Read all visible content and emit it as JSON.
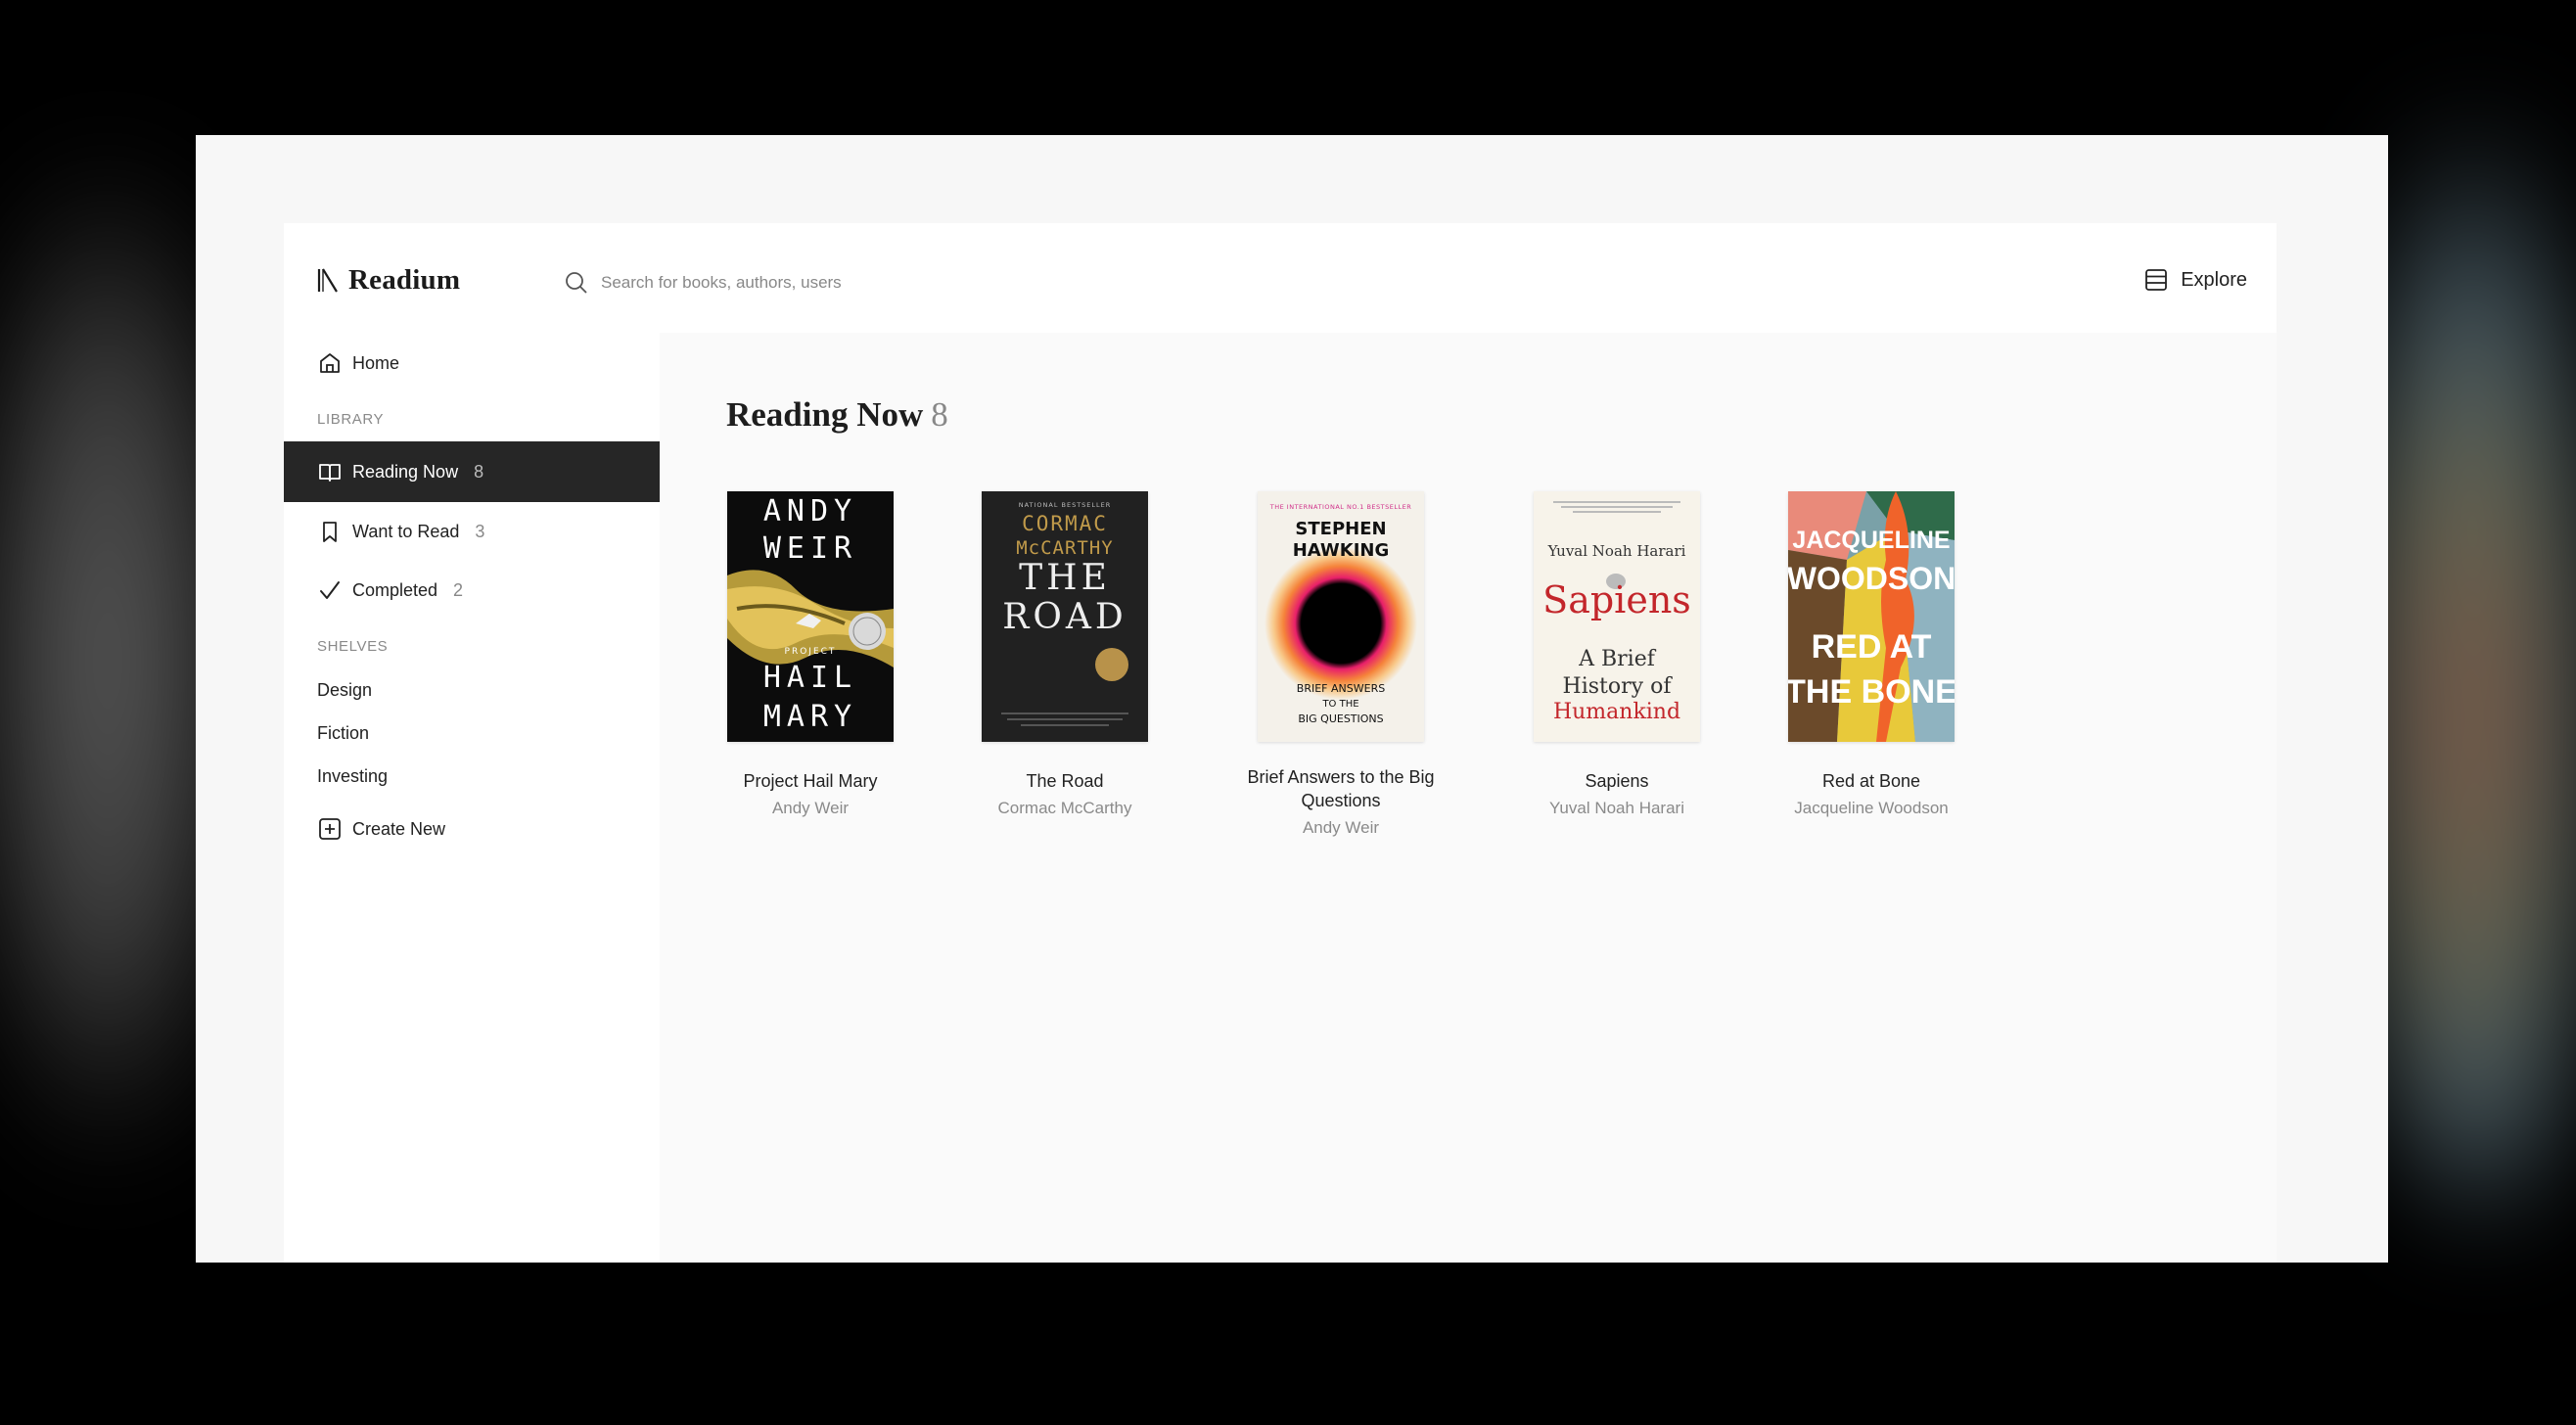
{
  "app": {
    "name": "Readium"
  },
  "search": {
    "placeholder": "Search for books, authors, users"
  },
  "topbar": {
    "explore_label": "Explore"
  },
  "sidebar": {
    "home_label": "Home",
    "library_heading": "LIBRARY",
    "library": [
      {
        "label": "Reading Now",
        "count": "8",
        "active": true,
        "icon": "book-open-icon"
      },
      {
        "label": "Want to Read",
        "count": "3",
        "active": false,
        "icon": "bookmark-icon"
      },
      {
        "label": "Completed",
        "count": "2",
        "active": false,
        "icon": "check-icon"
      }
    ],
    "shelves_heading": "SHELVES",
    "shelves": [
      {
        "label": "Design"
      },
      {
        "label": "Fiction"
      },
      {
        "label": "Investing"
      }
    ],
    "create_new_label": "Create New"
  },
  "main": {
    "heading": "Reading Now",
    "heading_count": "8",
    "books": [
      {
        "title": "Project Hail Mary",
        "author": "Andy Weir",
        "cover": {
          "line1": "ANDY",
          "line2": "WEIR",
          "small": "PROJECT",
          "line3": "HAIL",
          "line4": "MARY"
        }
      },
      {
        "title": "The Road",
        "author": "Cormac McCarthy",
        "cover": {
          "top": "NATIONAL BESTSELLER",
          "line1": "CORMAC",
          "line2": "McCARTHY",
          "line3": "THE",
          "line4": "ROAD"
        }
      },
      {
        "title": "Brief Answers to the Big Questions",
        "author": "Andy Weir",
        "cover": {
          "top": "THE INTERNATIONAL NO.1 BESTSELLER",
          "line1": "STEPHEN",
          "line2": "HAWKING",
          "line3": "BRIEF ANSWERS",
          "line4": "TO THE",
          "line5": "BIG QUESTIONS"
        }
      },
      {
        "title": "Sapiens",
        "author": "Yuval Noah Harari",
        "cover": {
          "line1": "Yuval Noah Harari",
          "line2": "Sapiens",
          "line3": "A Brief",
          "line4": "History of",
          "line5": "Humankind"
        }
      },
      {
        "title": "Red at Bone",
        "author": "Jacqueline Woodson",
        "cover": {
          "line1": "JACQUELINE",
          "line2": "WOODSON",
          "line3": "RED AT",
          "line4": "THE BONE"
        }
      }
    ]
  },
  "colors": {
    "active_bg": "#262626",
    "muted": "#888888",
    "page_bg": "#fafafa"
  }
}
